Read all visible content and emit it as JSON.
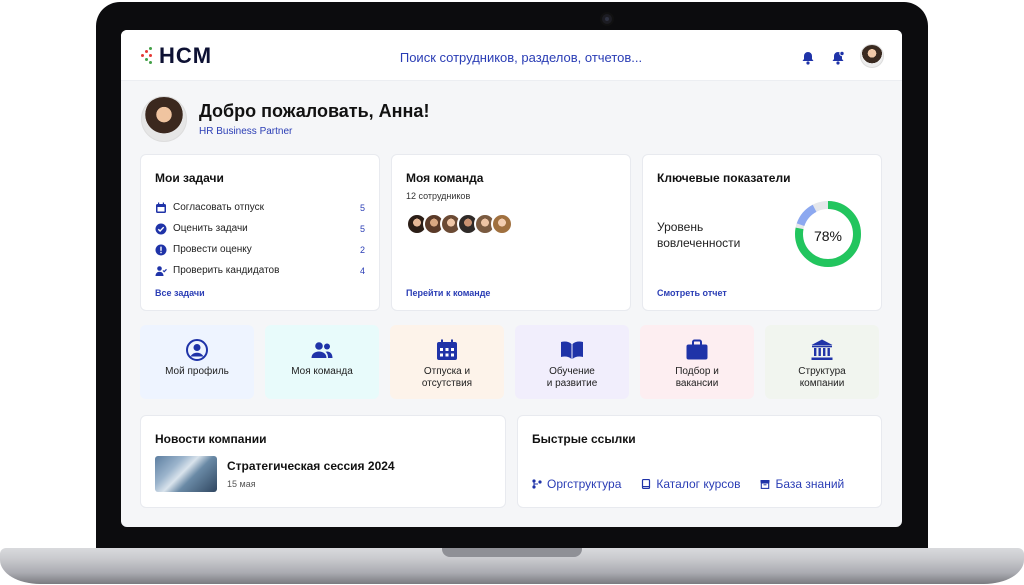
{
  "header": {
    "logo_text": "HCM",
    "search_placeholder": "Поиск сотрудников, разделов, отчетов..."
  },
  "welcome": {
    "title": "Добро пожаловать, Анна!",
    "role": "HR Business Partner"
  },
  "tasks": {
    "title": "Мои задачи",
    "items": [
      {
        "label": "Согласовать отпуск",
        "count": "5",
        "icon": "calendar-icon"
      },
      {
        "label": "Оценить задачи",
        "count": "5",
        "icon": "check-circle-icon"
      },
      {
        "label": "Провести оценку",
        "count": "2",
        "icon": "alert-circle-icon"
      },
      {
        "label": "Проверить кандидатов",
        "count": "4",
        "icon": "user-check-icon"
      }
    ],
    "link": "Все задачи"
  },
  "team": {
    "title": "Моя команда",
    "count_label": "12 сотрудников",
    "link": "Перейти к команде"
  },
  "kpi": {
    "title": "Ключевые показатели",
    "label": "Уровень вовлеченности",
    "value_label": "78%",
    "value": 0.78,
    "link": "Смотреть отчет",
    "colors": {
      "progress": "#22c55e",
      "rest": "#8ca8f0",
      "track": "#e5e7eb"
    }
  },
  "tiles": [
    {
      "label": "Мой профиль",
      "icon": "user-circle-icon",
      "bg": "#eef4ff"
    },
    {
      "label": "Моя команда",
      "icon": "team-icon",
      "bg": "#e8fbfb"
    },
    {
      "label": "Отпуска и\nотсутствия",
      "icon": "calendar-icon",
      "bg": "#fdf3ea"
    },
    {
      "label": "Обучение\nи развитие",
      "icon": "book-icon",
      "bg": "#f1eefc"
    },
    {
      "label": "Подбор и\nвакансии",
      "icon": "briefcase-icon",
      "bg": "#fdeef1"
    },
    {
      "label": "Структура\nкомпании",
      "icon": "bank-icon",
      "bg": "#f1f5ef"
    }
  ],
  "news": {
    "title": "Новости компании",
    "item_title": "Стратегическая сессия 2024",
    "item_date": "15 мая"
  },
  "quick_links": {
    "title": "Быстрые ссылки",
    "items": [
      {
        "label": "Оргструктура",
        "icon": "org-icon"
      },
      {
        "label": "Каталог курсов",
        "icon": "book-icon"
      },
      {
        "label": "База знаний",
        "icon": "archive-icon"
      }
    ]
  },
  "colors": {
    "accent": "#2a3db5",
    "icon": "#1f33a8"
  }
}
